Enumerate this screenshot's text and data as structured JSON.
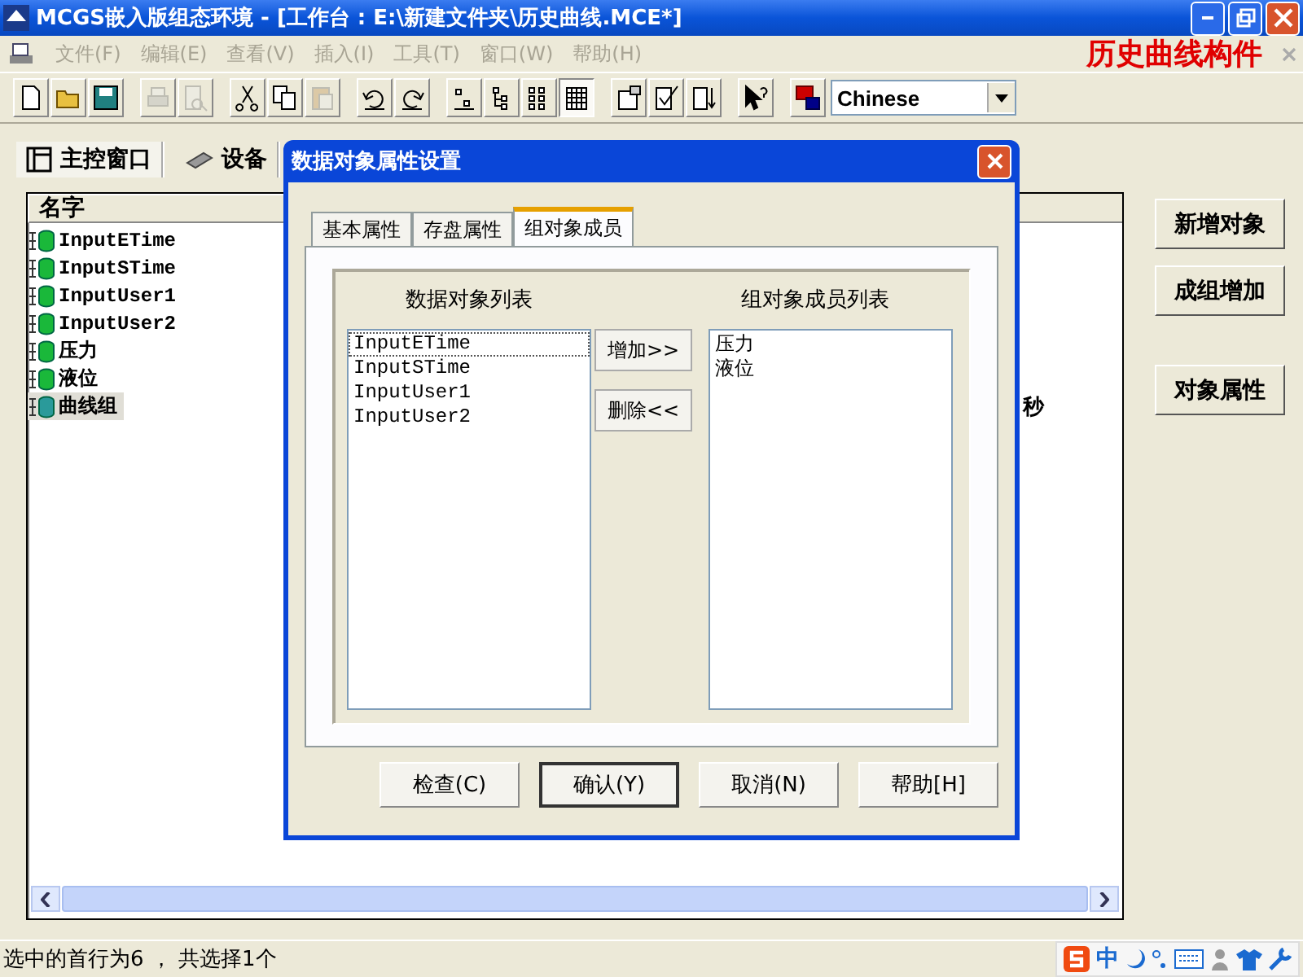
{
  "window": {
    "title": "MCGS嵌入版组态环境 - [工作台 : E:\\新建文件夹\\历史曲线.MCE*]"
  },
  "menu": [
    {
      "label": "文件(F)",
      "disabled": true
    },
    {
      "label": "编辑(E)",
      "disabled": true
    },
    {
      "label": "查看(V)",
      "disabled": true
    },
    {
      "label": "插入(I)",
      "disabled": true
    },
    {
      "label": "工具(T)",
      "disabled": true
    },
    {
      "label": "窗口(W)",
      "disabled": true
    },
    {
      "label": "帮助(H)",
      "disabled": true
    }
  ],
  "overlay_caption": "历史曲线构件",
  "toolbar": [
    {
      "disabled": false,
      "pressed": false
    },
    {
      "disabled": false,
      "pressed": false
    },
    {
      "disabled": false,
      "pressed": false
    },
    {
      "disabled": true,
      "pressed": false
    },
    {
      "disabled": true,
      "pressed": false
    },
    {
      "disabled": false,
      "pressed": false
    },
    {
      "disabled": false,
      "pressed": false
    },
    {
      "disabled": true,
      "pressed": false
    },
    {
      "disabled": false,
      "pressed": false
    },
    {
      "disabled": false,
      "pressed": false
    },
    {
      "disabled": false,
      "pressed": false
    },
    {
      "disabled": false,
      "pressed": false
    },
    {
      "disabled": false,
      "pressed": false
    },
    {
      "disabled": false,
      "pressed": true
    },
    {
      "disabled": false,
      "pressed": false
    },
    {
      "disabled": false,
      "pressed": false
    },
    {
      "disabled": false,
      "pressed": false
    },
    {
      "disabled": false,
      "pressed": false
    },
    {
      "disabled": false,
      "pressed": false
    }
  ],
  "language_select": {
    "value": "Chinese"
  },
  "workspace_tabs": [
    {
      "label": "主控窗口",
      "selected": true
    },
    {
      "label": "设备",
      "selected": false
    }
  ],
  "table": {
    "columns": [
      "名字"
    ],
    "rows": [
      {
        "name": "InputETime",
        "selected": false
      },
      {
        "name": "InputSTime",
        "selected": false
      },
      {
        "name": "InputUser1",
        "selected": false
      },
      {
        "name": "InputUser2",
        "selected": false
      },
      {
        "name": "压力",
        "selected": false
      },
      {
        "name": "液位",
        "selected": false
      },
      {
        "name": "曲线组",
        "selected": true,
        "column_2": "秒"
      }
    ]
  },
  "side_buttons": [
    "新增对象",
    "成组增加",
    "对象属性"
  ],
  "status_bar": {
    "text": "选中的首行为6 ， 共选择1个",
    "tray_text": "中"
  },
  "dialog": {
    "title": "数据对象属性设置",
    "tabs": [
      {
        "label": "基本属性",
        "selected": false
      },
      {
        "label": "存盘属性",
        "selected": false
      },
      {
        "label": "组对象成员",
        "selected": true
      }
    ],
    "left_list": {
      "label": "数据对象列表",
      "items": [
        {
          "text": "InputETime",
          "focused": true
        },
        {
          "text": "InputSTime",
          "focused": false
        },
        {
          "text": "InputUser1",
          "focused": false
        },
        {
          "text": "InputUser2",
          "focused": false
        }
      ]
    },
    "right_list": {
      "label": "组对象成员列表",
      "items": [
        "压力",
        "液位"
      ]
    },
    "add_button": "增加>>",
    "remove_button": "删除<<",
    "buttons": [
      {
        "label": "检查(C)",
        "default": false
      },
      {
        "label": "确认(Y)",
        "default": true
      },
      {
        "label": "取消(N)",
        "default": false
      },
      {
        "label": "帮助[H]",
        "default": false
      }
    ]
  }
}
